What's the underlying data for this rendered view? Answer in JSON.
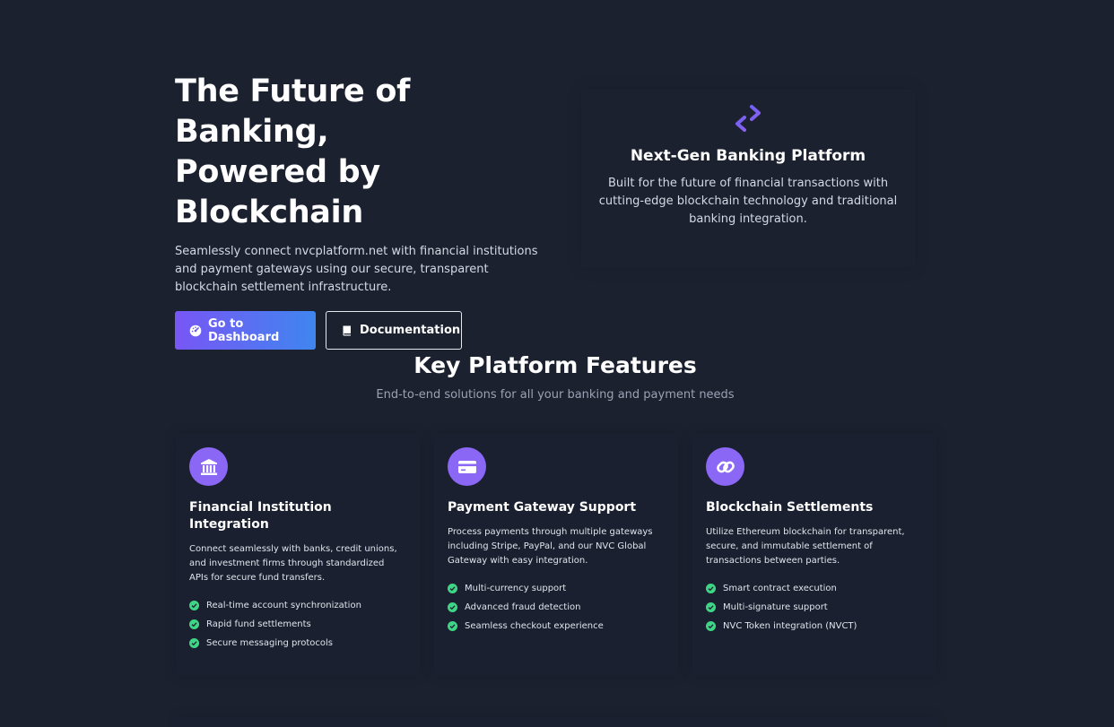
{
  "hero": {
    "title_line1": "The Future of Banking,",
    "title_line2": "Powered by Blockchain",
    "description": "Seamlessly connect nvcplatform.net with financial institutions and payment gateways using our secure, transparent blockchain settlement infrastructure.",
    "primary_button": "Go to Dashboard",
    "secondary_button": "Documentation",
    "primary_icon": "dashboard-gauge-icon",
    "secondary_icon": "book-icon"
  },
  "highlight": {
    "icon": "exchange-arrows-icon",
    "title": "Next-Gen Banking Platform",
    "description": "Built for the future of financial transactions with cutting-edge blockchain technology and traditional banking integration."
  },
  "features": {
    "title": "Key Platform Features",
    "subtitle": "End-to-end solutions for all your banking and payment needs",
    "cards": [
      {
        "icon": "bank-icon",
        "title": "Financial Institution Integration",
        "description": "Connect seamlessly with banks, credit unions, and investment firms through standardized APIs for secure fund transfers.",
        "items": [
          "Real-time account synchronization",
          "Rapid fund settlements",
          "Secure messaging protocols"
        ]
      },
      {
        "icon": "credit-card-icon",
        "title": "Payment Gateway Support",
        "description": "Process payments through multiple gateways including Stripe, PayPal, and our NVC Global Gateway with easy integration.",
        "items": [
          "Multi-currency support",
          "Advanced fraud detection",
          "Seamless checkout experience"
        ]
      },
      {
        "icon": "chain-link-icon",
        "title": "Blockchain Settlements",
        "description": "Utilize Ethereum blockchain for transparent, secure, and immutable settlement of transactions between parties.",
        "items": [
          "Smart contract execution",
          "Multi-signature support",
          "NVC Token integration (NVCT)"
        ]
      }
    ]
  },
  "colors": {
    "background": "#1c2130",
    "accent_purple": "#8a67f5",
    "accent_blue": "#3f86ef",
    "check_green": "#3ed685"
  }
}
